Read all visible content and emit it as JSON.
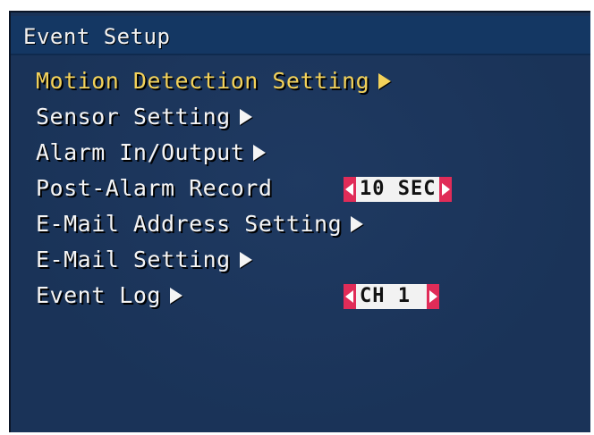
{
  "window": {
    "title": "Event Setup"
  },
  "menu": {
    "items": [
      {
        "label": "Motion Detection Setting",
        "arrow": "right-arrow-icon",
        "selected": true
      },
      {
        "label": "Sensor Setting",
        "arrow": "right-arrow-icon",
        "selected": false
      },
      {
        "label": "Alarm In/Output",
        "arrow": "right-arrow-icon",
        "selected": false
      },
      {
        "label": "Post-Alarm Record",
        "selected": false
      },
      {
        "label": "E-Mail Address Setting",
        "arrow": "right-arrow-icon",
        "selected": false
      },
      {
        "label": "E-Mail Setting",
        "arrow": "right-arrow-icon",
        "selected": false
      },
      {
        "label": "Event Log",
        "arrow": "right-arrow-icon",
        "selected": false
      }
    ]
  },
  "post_alarm": {
    "value": "10 SEC"
  },
  "event_log": {
    "channel": "CH 1"
  },
  "colors": {
    "background": "#1a3358",
    "selected_text": "#f3d25a",
    "normal_text": "#f5f5f5",
    "selector_accent": "#e02c58"
  }
}
